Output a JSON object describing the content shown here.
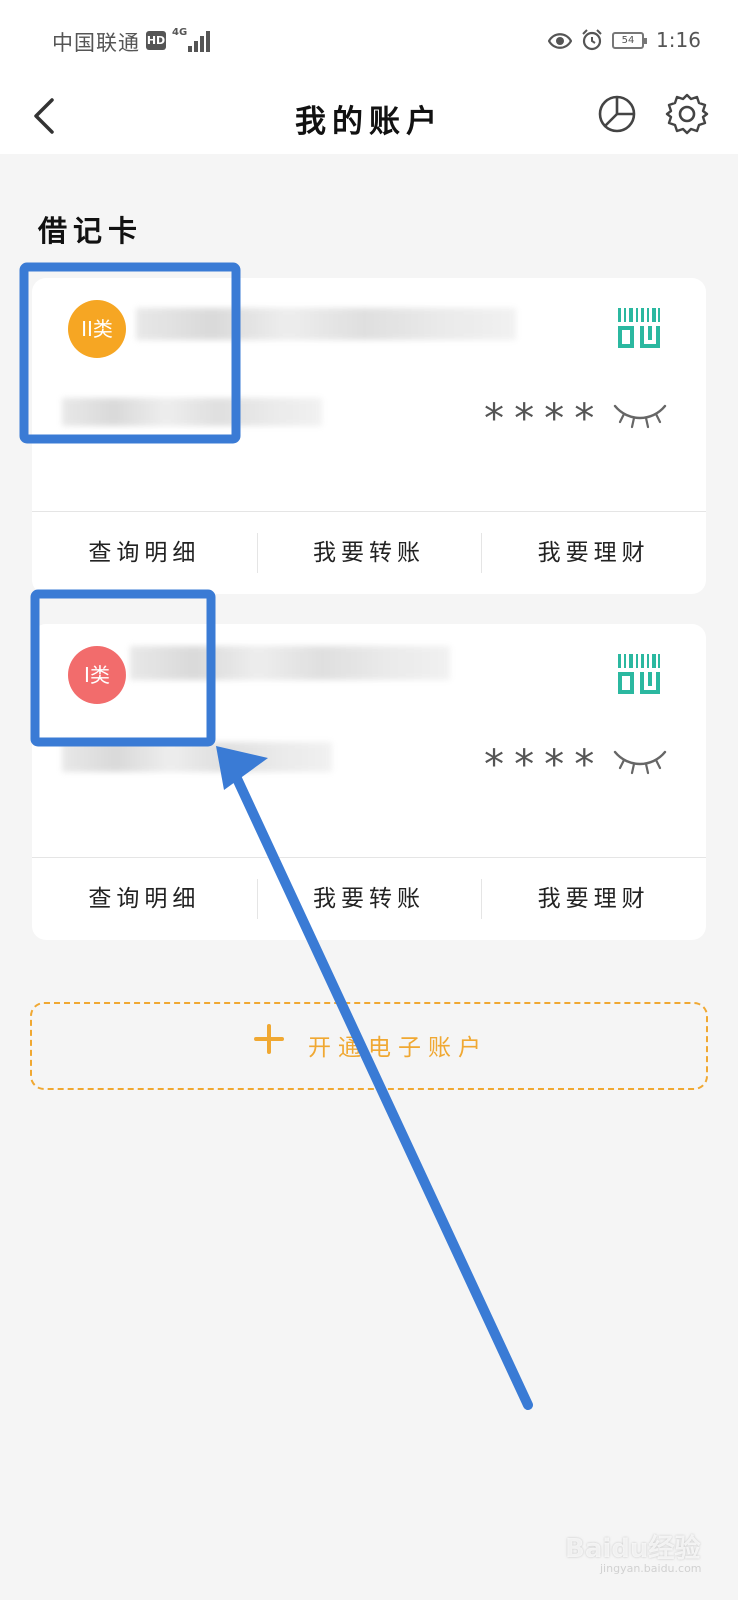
{
  "status_bar": {
    "carrier": "中国联通",
    "hd": "HD",
    "network": "4G",
    "battery": "54",
    "time": "1:16"
  },
  "nav": {
    "title": "我的账户",
    "back_icon": "chevron-left-icon",
    "chart_icon": "pie-chart-icon",
    "settings_icon": "gear-icon"
  },
  "section": {
    "title": "借记卡"
  },
  "cards": [
    {
      "badge": "II类",
      "badge_color": "#f6a623",
      "balance_mask": "****",
      "actions": [
        "查询明细",
        "我要转账",
        "我要理财"
      ]
    },
    {
      "badge": "I类",
      "badge_color": "#f26c6c",
      "balance_mask": "****",
      "actions": [
        "查询明细",
        "我要转账",
        "我要理财"
      ]
    }
  ],
  "open_account": {
    "label": "开通电子账户",
    "icon": "plus-icon",
    "color": "#f0a832"
  },
  "annotation": {
    "color": "#3a7bd5"
  },
  "watermark": {
    "text": "Baidu经验",
    "sub": "jingyan.baidu.com"
  }
}
